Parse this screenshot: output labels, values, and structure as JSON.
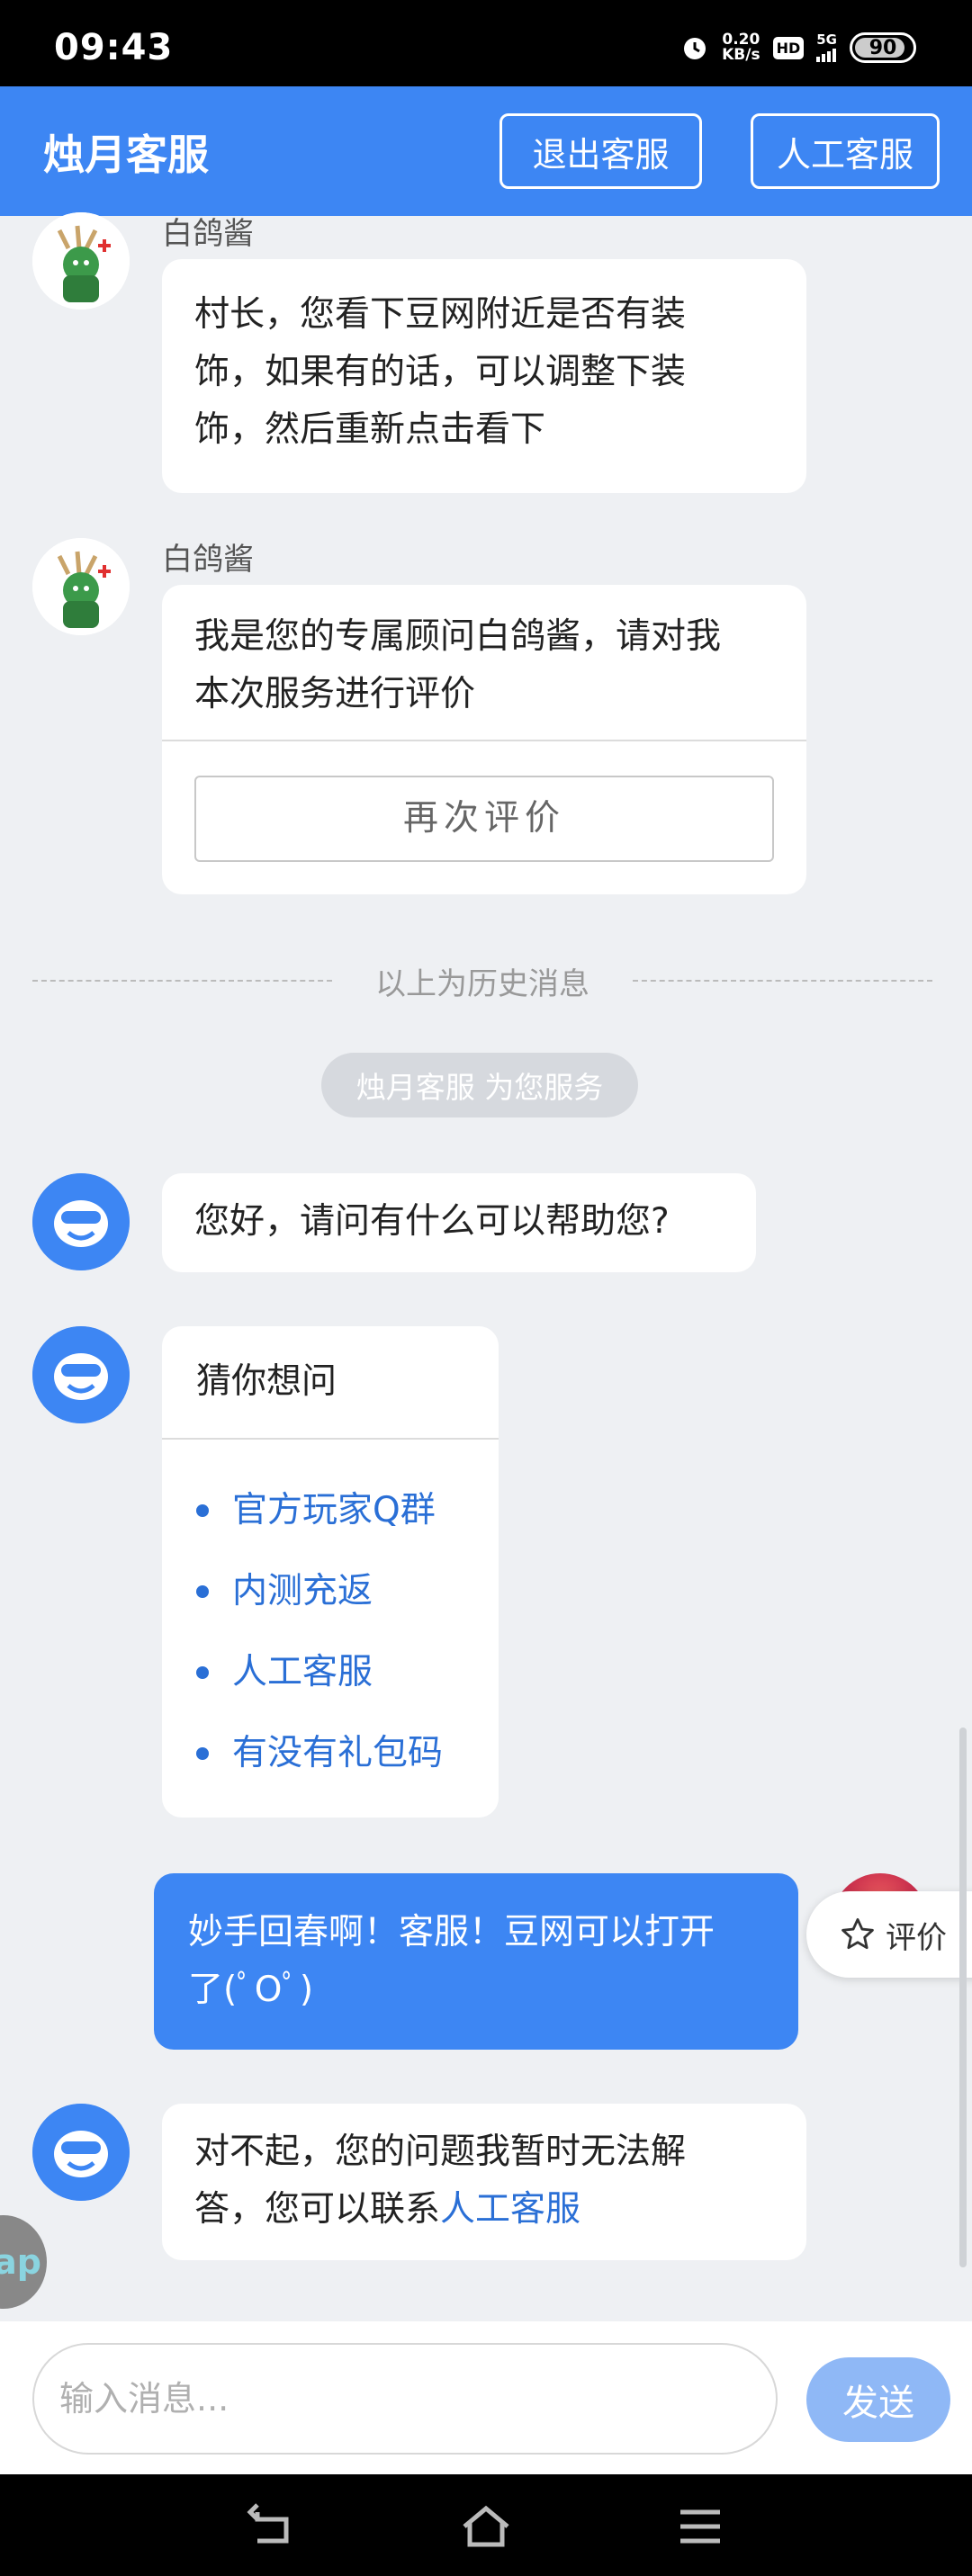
{
  "status_bar": {
    "time": "09:43",
    "net_speed_value": "0.20",
    "net_speed_unit": "KB/s",
    "hd_label": "HD",
    "network": "5G",
    "battery": "90",
    "icons": [
      "alarm-icon",
      "hd-icon",
      "signal-icon",
      "battery-icon"
    ]
  },
  "header": {
    "title": "烛月客服",
    "exit_label": "退出客服",
    "human_label": "人工客服"
  },
  "history": {
    "msg1": {
      "sender": "白鸽酱",
      "lines": [
        "村长，您看下豆网附近是否有装",
        "饰，如果有的话，可以调整下装",
        "饰，然后重新点击看下"
      ]
    },
    "msg2": {
      "sender": "白鸽酱",
      "lines": [
        "我是您的专属顾问白鸽酱，请对我",
        "本次服务进行评价"
      ],
      "rate_again_label": "再次评价"
    },
    "divider_label": "以上为历史消息"
  },
  "service_notice": "烛月客服 为您服务",
  "bot_greeting": "您好，请问有什么可以帮助您?",
  "guess": {
    "title": "猜你想问",
    "items": [
      "官方玩家Q群",
      "内测充返",
      "人工客服",
      "有没有礼包码"
    ]
  },
  "user_message": {
    "lines": [
      "妙手回春啊！客服！豆网可以打开",
      "了(ﾟOﾟ)"
    ]
  },
  "bot_reply": {
    "line1": "对不起，您的问题我暂时无法解",
    "line2_prefix": "答，您可以联系",
    "line2_link": "人工客服"
  },
  "rate_float_label": "评价",
  "app_float_label": "ap",
  "input": {
    "placeholder": "输入消息...",
    "send_label": "发送"
  },
  "nav": {
    "icons": [
      "back-icon",
      "home-icon",
      "menu-icon"
    ]
  },
  "colors": {
    "brand_blue": "#3d86f3",
    "link_blue": "#2a6fd6",
    "background": "#eef0f3"
  }
}
